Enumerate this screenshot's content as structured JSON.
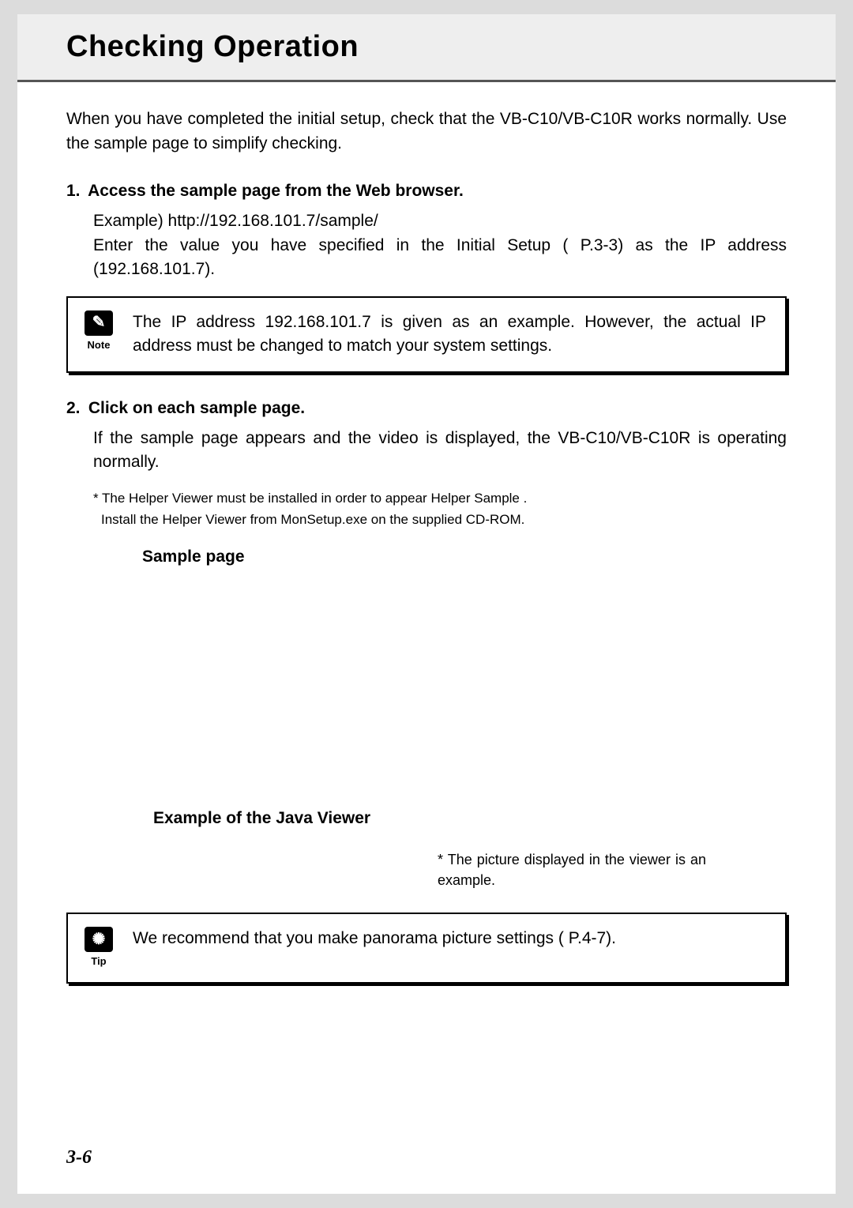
{
  "header": {
    "title": "Checking Operation"
  },
  "intro": "When you have completed the initial setup, check that the VB-C10/VB-C10R works normally. Use the sample page to simplify checking.",
  "steps": [
    {
      "num": "1.",
      "title": "Access the sample page from the Web browser.",
      "line1": "Example) http://192.168.101.7/sample/",
      "line2": "Enter the value you have specified in the Initial Setup (   P.3-3) as the IP address (192.168.101.7)."
    },
    {
      "num": "2.",
      "title": "Click on each sample page.",
      "line1": "If the sample page appears and the video is displayed, the VB-C10/VB-C10R is operating normally."
    }
  ],
  "note": {
    "label": "Note",
    "iconText": "✎",
    "text": "The IP address  192.168.101.7  is given as an example. However, the actual IP address must be changed to match your system settings."
  },
  "asterisk1": "* The Helper Viewer must be installed in order to appear  Helper Sample .",
  "asterisk2": "Install the Helper Viewer from  MonSetup.exe  on the supplied CD-ROM.",
  "sampleLabel": "Sample page",
  "javaLabel": "Example of the Java Viewer",
  "picNote": "* The picture displayed in the viewer is an example.",
  "tip": {
    "label": "Tip",
    "iconText": "✺",
    "text": "We recommend that you make panorama picture settings (   P.4-7)."
  },
  "pageNum": "3-6"
}
